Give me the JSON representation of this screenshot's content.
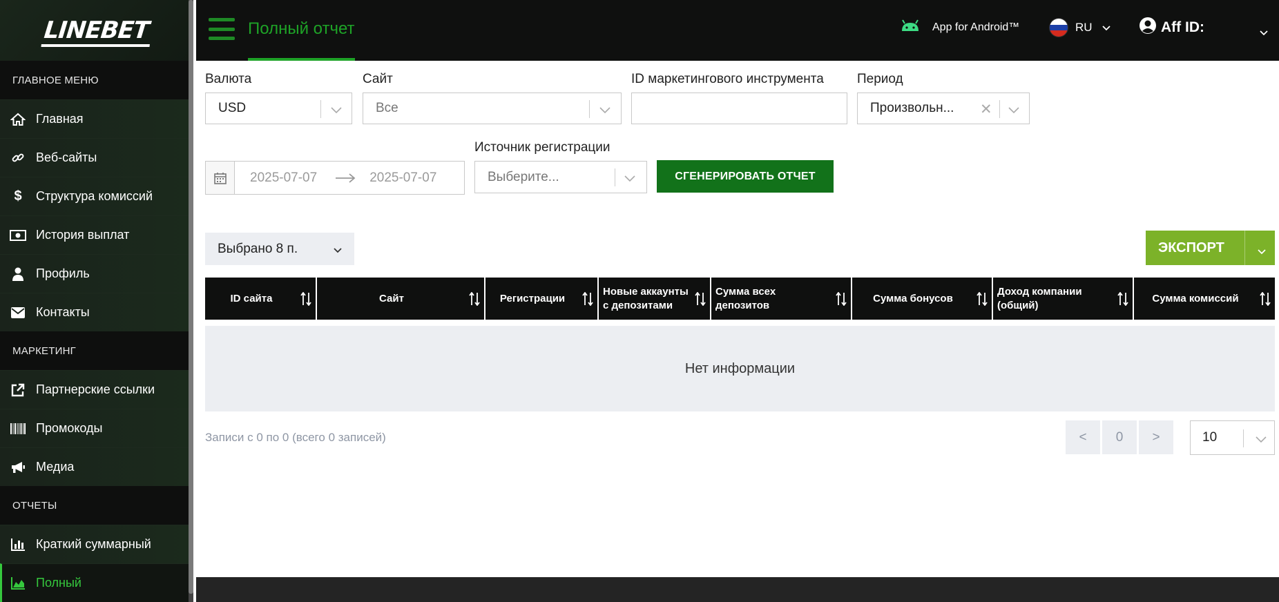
{
  "brand": {
    "logo_text": "LINEBET"
  },
  "sidebar": {
    "sections": [
      {
        "title": "ГЛАВНОЕ МЕНЮ",
        "items": [
          {
            "label": "Главная",
            "icon": "home-icon"
          },
          {
            "label": "Веб-сайты",
            "icon": "link-icon"
          },
          {
            "label": "Структура комиссий",
            "icon": "dollar-icon"
          },
          {
            "label": "История выплат",
            "icon": "money-icon"
          },
          {
            "label": "Профиль",
            "icon": "user-icon"
          },
          {
            "label": "Контакты",
            "icon": "envelope-icon"
          }
        ]
      },
      {
        "title": "МАРКЕТИНГ",
        "items": [
          {
            "label": "Партнерские ссылки",
            "icon": "external-link-icon"
          },
          {
            "label": "Промокоды",
            "icon": "barcode-icon"
          },
          {
            "label": "Медиа",
            "icon": "megaphone-icon"
          }
        ]
      },
      {
        "title": "ОТЧЕТЫ",
        "items": [
          {
            "label": "Краткий суммарный",
            "icon": "bar-chart-icon"
          },
          {
            "label": "Полный",
            "icon": "area-chart-icon",
            "active": true
          }
        ]
      }
    ]
  },
  "header": {
    "page_title": "Полный отчет",
    "android_label": "App for Android™",
    "language": "RU",
    "aff_label": "Aff ID:"
  },
  "filters": {
    "currency": {
      "label": "Валюта",
      "value": "USD"
    },
    "site": {
      "label": "Сайт",
      "value": "Все"
    },
    "marketing_id": {
      "label": "ID маркетингового инструмента",
      "value": ""
    },
    "period": {
      "label": "Период",
      "value": "Произвольн..."
    },
    "date_from": "2025-07-07",
    "date_to": "2025-07-07",
    "reg_source": {
      "label": "Источник регистрации",
      "placeholder": "Выберите..."
    },
    "generate_label": "СГЕНЕРИРОВАТЬ ОТЧЕТ"
  },
  "toolbar": {
    "columns_selected": "Выбрано 8 п.",
    "export_label": "ЭКСПОРТ"
  },
  "table": {
    "columns": [
      "ID сайта",
      "Сайт",
      "Регистрации",
      "Новые аккаунты с депозитами",
      "Сумма всех депозитов",
      "Сумма бонусов",
      "Доход компании (общий)",
      "Сумма комиссий"
    ],
    "empty_text": "Нет информации"
  },
  "pagination": {
    "info": "Записи с 0 по 0 (всего 0 записей)",
    "prev": "<",
    "current": "0",
    "next": ">",
    "page_size": "10"
  },
  "colors": {
    "accent_green": "#1ea327",
    "generate_btn": "#12721a",
    "export_btn": "#7cb229",
    "dark": "#0f100f"
  }
}
